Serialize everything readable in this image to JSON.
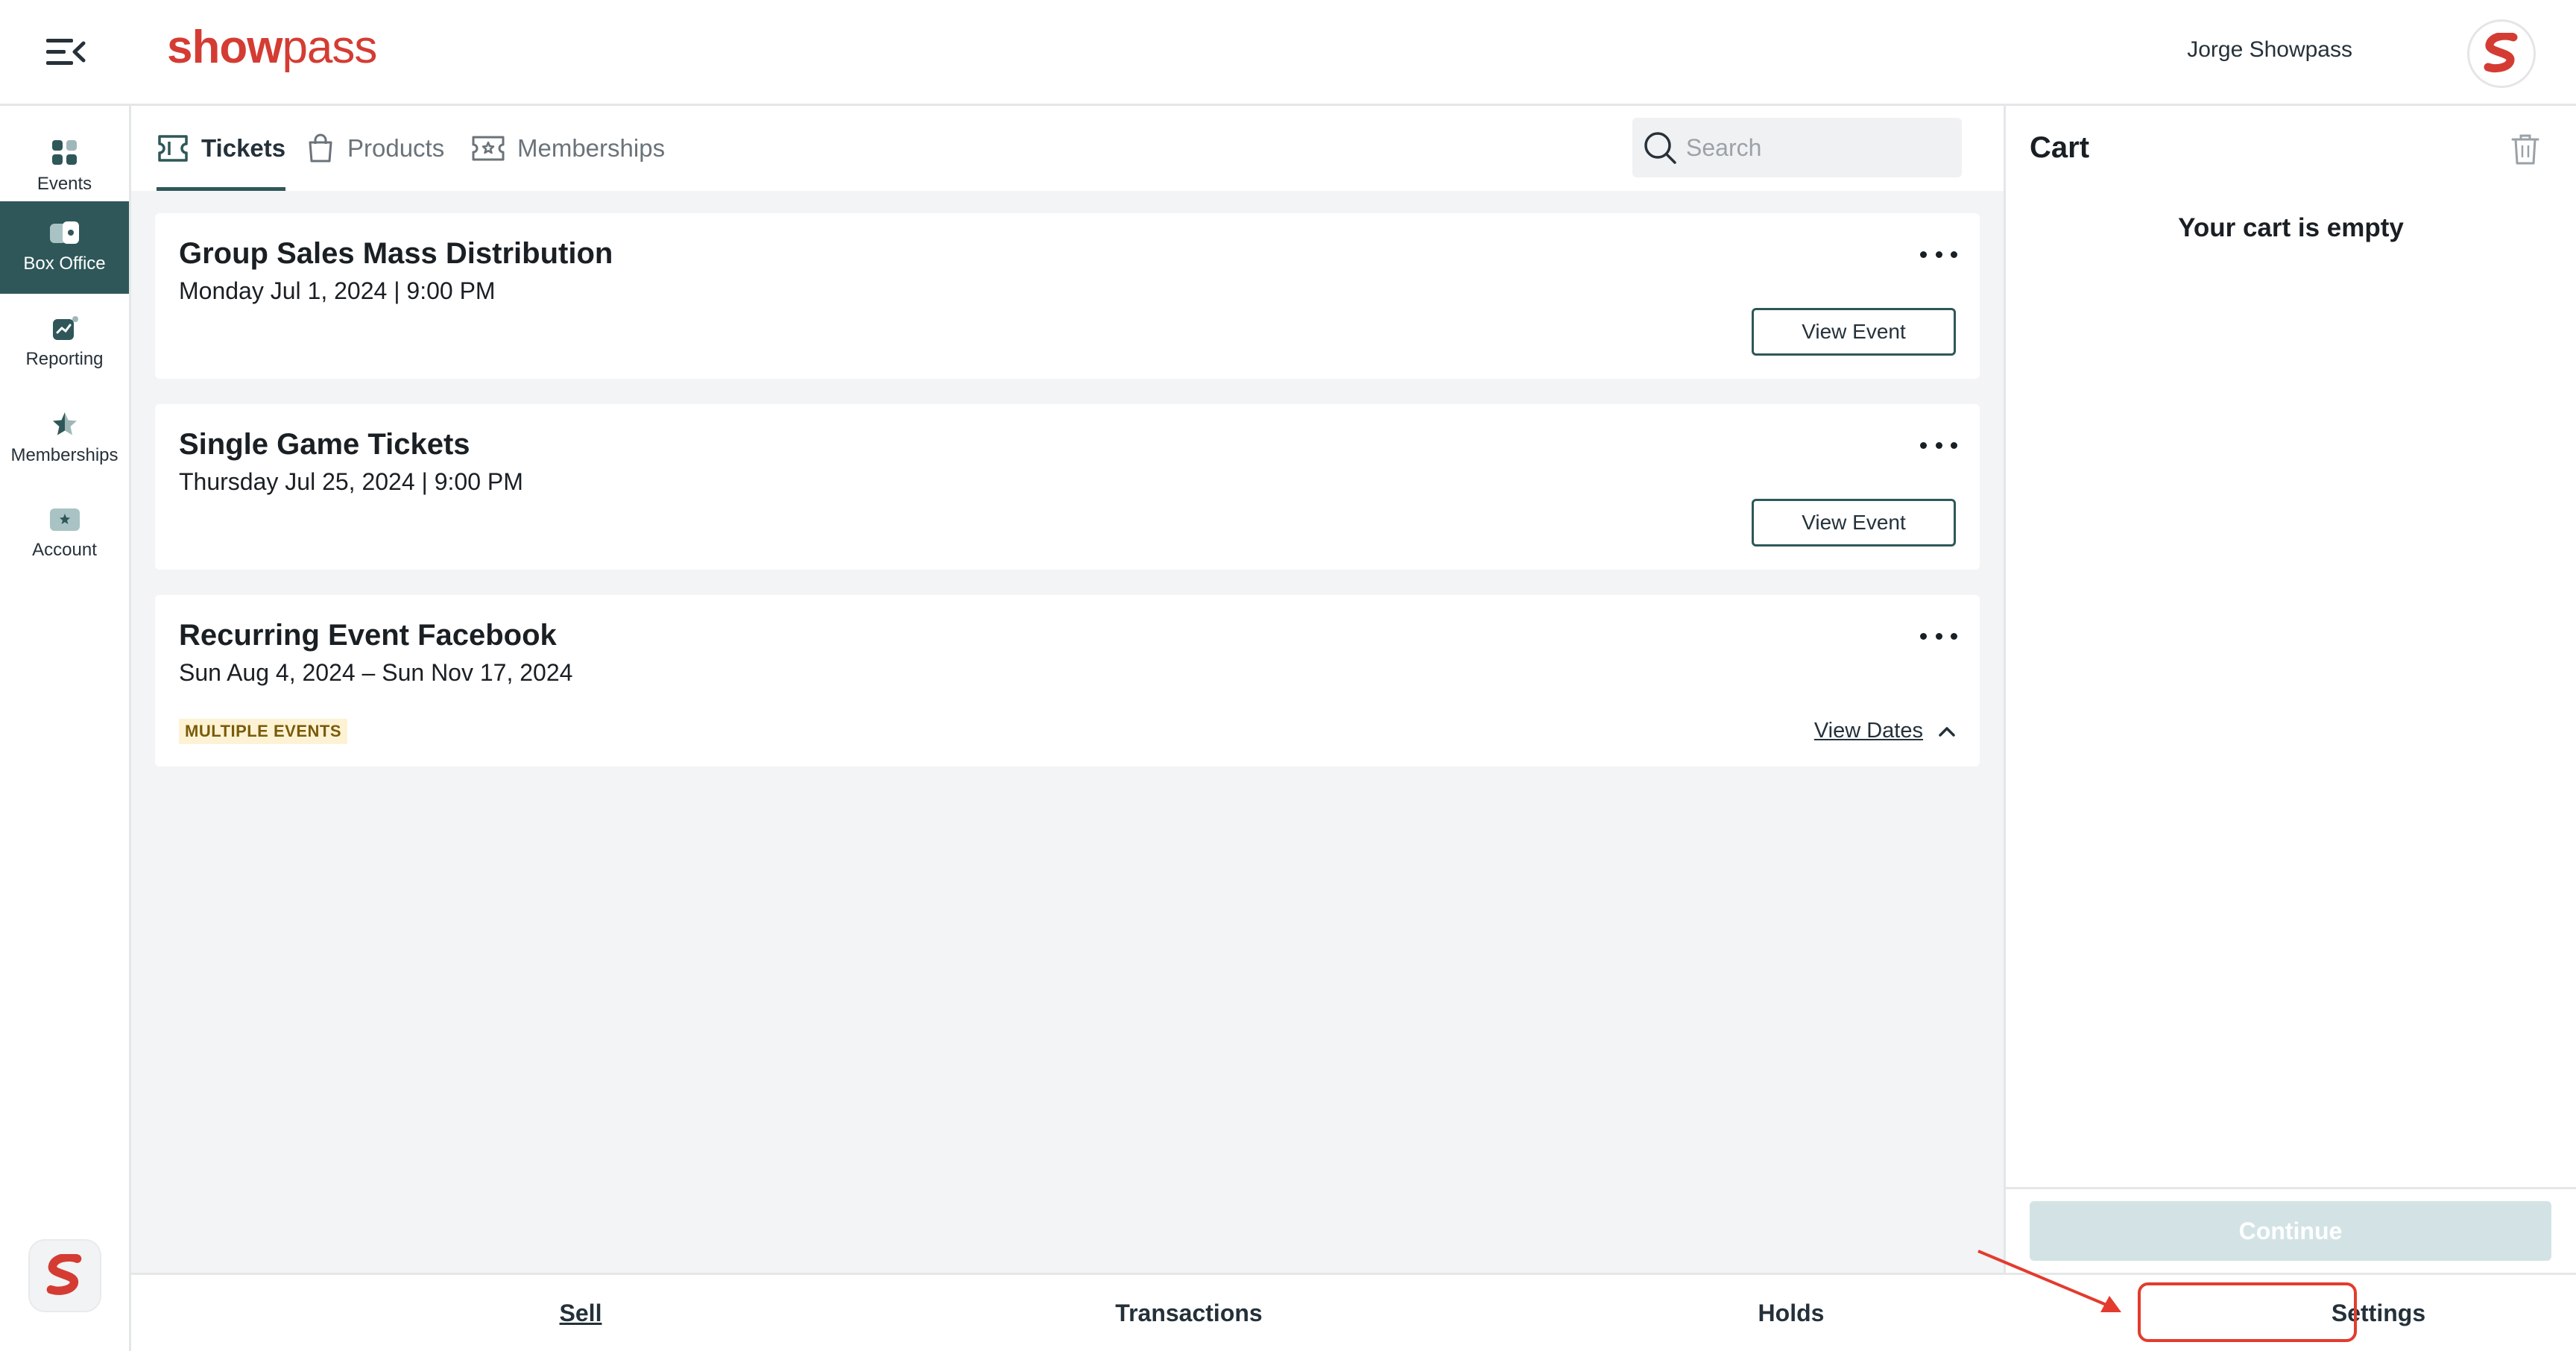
{
  "header": {
    "brand_bold": "show",
    "brand_light": "pass",
    "user_name": "Jorge Showpass"
  },
  "nav": {
    "items": [
      {
        "label": "Events",
        "icon": "grid-icon"
      },
      {
        "label": "Box Office",
        "icon": "box-office-icon",
        "active": true
      },
      {
        "label": "Reporting",
        "icon": "chart-icon"
      },
      {
        "label": "Memberships",
        "icon": "star-icon"
      },
      {
        "label": "Account",
        "icon": "account-icon"
      }
    ]
  },
  "tabs": [
    {
      "label": "Tickets",
      "icon": "ticket-icon",
      "active": true
    },
    {
      "label": "Products",
      "icon": "bag-icon"
    },
    {
      "label": "Memberships",
      "icon": "membership-card-icon"
    }
  ],
  "search": {
    "placeholder": "Search",
    "value": ""
  },
  "events": [
    {
      "title": "Group Sales Mass Distribution",
      "date": "Monday Jul 1, 2024 | 9:00 PM",
      "action": "View Event"
    },
    {
      "title": "Single Game Tickets",
      "date": "Thursday Jul 25, 2024 | 9:00 PM",
      "action": "View Event"
    },
    {
      "title": "Recurring Event Facebook",
      "date": "Sun Aug 4, 2024 – Sun Nov 17, 2024",
      "badge": "MULTIPLE EVENTS",
      "action": "View Dates"
    }
  ],
  "cart": {
    "title": "Cart",
    "empty_message": "Your cart is empty",
    "continue_label": "Continue"
  },
  "bottom_tabs": [
    {
      "label": "Sell",
      "active": true
    },
    {
      "label": "Transactions"
    },
    {
      "label": "Holds"
    },
    {
      "label": "Settings",
      "highlighted": true
    }
  ],
  "colors": {
    "brand_red": "#d43c33",
    "nav_active": "#2f5759",
    "highlight": "#e33b2e"
  }
}
